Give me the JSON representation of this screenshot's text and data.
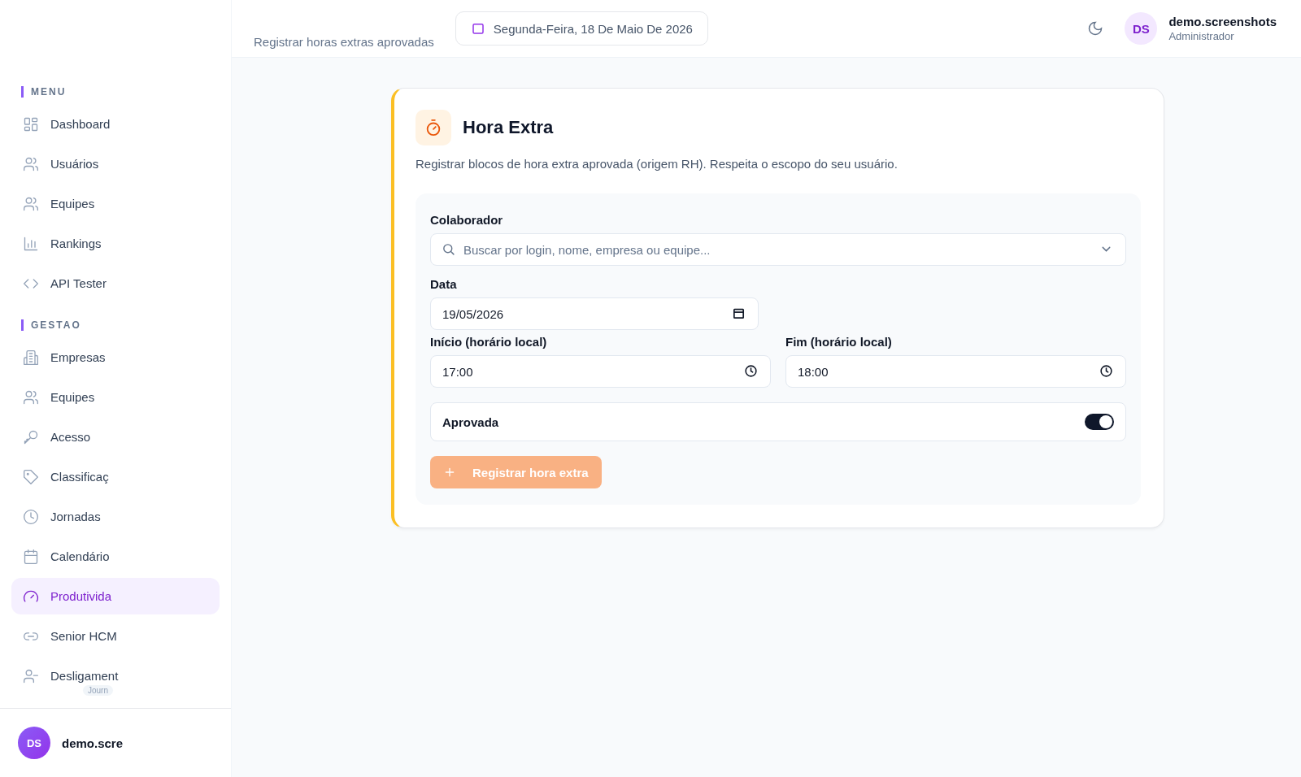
{
  "header": {
    "subtitle": "Registrar horas extras aprovadas",
    "date": "Segunda-Feira, 18 De Maio De 2026",
    "user": {
      "initials": "DS",
      "name": "demo.screenshots",
      "role": "Administrador"
    }
  },
  "sidebar": {
    "sections": [
      {
        "title": "MENU",
        "items": [
          {
            "label": "Dashboard",
            "selected": false
          },
          {
            "label": "Usuários",
            "selected": false
          },
          {
            "label": "Equipes",
            "selected": false
          },
          {
            "label": "Rankings",
            "selected": false
          },
          {
            "label": "API Tester",
            "selected": false
          }
        ]
      },
      {
        "title": "GESTAO",
        "items": [
          {
            "label": "Empresas",
            "selected": false
          },
          {
            "label": "Equipes",
            "selected": false
          },
          {
            "label": "Acesso",
            "selected": false
          },
          {
            "label": "Classificaç",
            "selected": false
          },
          {
            "label": "Jornadas",
            "selected": false
          },
          {
            "label": "Calendário",
            "selected": false
          },
          {
            "label": "Produtivida",
            "selected": true
          },
          {
            "label": "Senior HCM",
            "selected": false
          },
          {
            "label": "Desligament",
            "selected": false,
            "badge": "Journ"
          }
        ]
      }
    ],
    "user": {
      "initials": "DS",
      "name": "demo.scre"
    }
  },
  "card": {
    "title": "Hora Extra",
    "description": "Registrar blocos de hora extra aprovada (origem RH). Respeita o escopo do seu usuário.",
    "collaborator": {
      "label": "Colaborador",
      "placeholder": "Buscar por login, nome, empresa ou equipe..."
    },
    "date": {
      "label": "Data",
      "value": "19/05/2026"
    },
    "start": {
      "label": "Início (horário local)",
      "value": "17:00"
    },
    "end": {
      "label": "Fim (horário local)",
      "value": "18:00"
    },
    "approved": {
      "label": "Aprovada",
      "on": true
    },
    "submit": {
      "label": "Registrar hora extra",
      "disabled": true
    }
  }
}
